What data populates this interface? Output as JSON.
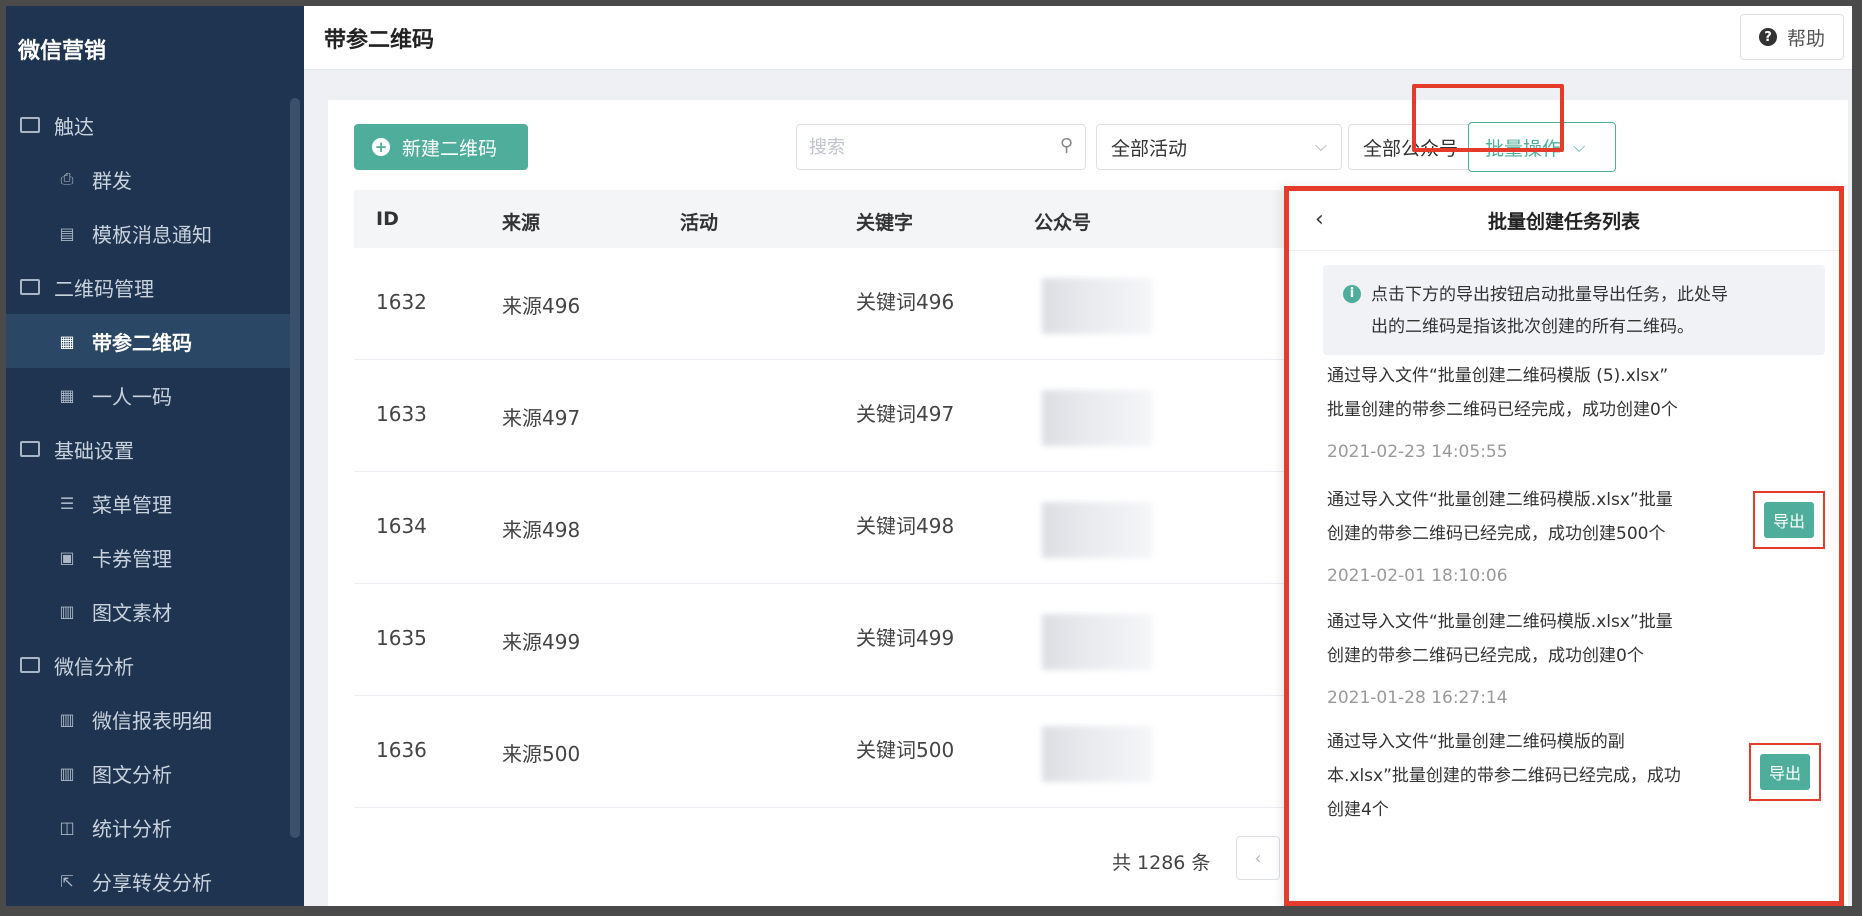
{
  "sidebar": {
    "brand": "微信营销",
    "items": [
      {
        "label": "触达",
        "type": "group",
        "icon": "folder-icon"
      },
      {
        "label": "群发",
        "type": "sub",
        "icon": "broadcast-icon"
      },
      {
        "label": "模板消息通知",
        "type": "sub",
        "icon": "template-icon"
      },
      {
        "label": "二维码管理",
        "type": "group",
        "icon": "folder-icon"
      },
      {
        "label": "带参二维码",
        "type": "sub",
        "icon": "qrcode-icon",
        "active": true
      },
      {
        "label": "一人一码",
        "type": "sub",
        "icon": "qrcode-icon"
      },
      {
        "label": "基础设置",
        "type": "group",
        "icon": "folder-icon"
      },
      {
        "label": "菜单管理",
        "type": "sub",
        "icon": "list-icon"
      },
      {
        "label": "卡券管理",
        "type": "sub",
        "icon": "coupon-icon"
      },
      {
        "label": "图文素材",
        "type": "sub",
        "icon": "document-icon"
      },
      {
        "label": "微信分析",
        "type": "group",
        "icon": "folder-icon"
      },
      {
        "label": "微信报表明细",
        "type": "sub",
        "icon": "document-icon"
      },
      {
        "label": "图文分析",
        "type": "sub",
        "icon": "document-icon"
      },
      {
        "label": "统计分析",
        "type": "sub",
        "icon": "chart-icon"
      },
      {
        "label": "分享转发分析",
        "type": "sub",
        "icon": "share-icon"
      }
    ]
  },
  "header": {
    "title": "带参二维码",
    "help_label": "帮助"
  },
  "toolbar": {
    "new_label": "新建二维码",
    "search_placeholder": "搜索",
    "activity_select": "全部活动",
    "account_select": "全部公众号",
    "batch_label": "批量操作"
  },
  "table": {
    "columns": [
      "ID",
      "来源",
      "活动",
      "关键字",
      "公众号"
    ],
    "rows": [
      {
        "id": "1632",
        "source": "来源496",
        "activity": "",
        "keyword": "关键词496"
      },
      {
        "id": "1633",
        "source": "来源497",
        "activity": "",
        "keyword": "关键词497"
      },
      {
        "id": "1634",
        "source": "来源498",
        "activity": "",
        "keyword": "关键词498"
      },
      {
        "id": "1635",
        "source": "来源499",
        "activity": "",
        "keyword": "关键词499"
      },
      {
        "id": "1636",
        "source": "来源500",
        "activity": "",
        "keyword": "关键词500"
      }
    ],
    "total": "共 1286 条"
  },
  "drawer": {
    "title": "批量创建任务列表",
    "notice_line1": "点击下方的导出按钮启动批量导出任务，此处导",
    "notice_line2": "出的二维码是指该批次创建的所有二维码。",
    "export_label": "导出",
    "tasks": [
      {
        "line1": "通过导入文件“批量创建二维码模版 (5).xlsx”",
        "line2": "批量创建的带参二维码已经完成，成功创建0个",
        "time": "2021-02-23 14:05:55",
        "exportable": false
      },
      {
        "line1": "通过导入文件“批量创建二维码模版.xlsx”批量",
        "line2": "创建的带参二维码已经完成，成功创建500个",
        "time": "2021-02-01 18:10:06",
        "exportable": true
      },
      {
        "line1": "通过导入文件“批量创建二维码模版.xlsx”批量",
        "line2": "创建的带参二维码已经完成，成功创建0个",
        "time": "2021-01-28 16:27:14",
        "exportable": false
      },
      {
        "line1": "通过导入文件“批量创建二维码模版的副",
        "line2": "本.xlsx”批量创建的带参二维码已经完成，成功",
        "line3": "创建4个",
        "exportable": true
      }
    ]
  },
  "colors": {
    "sidebar_bg": "#1e3450",
    "accent": "#4fae9b",
    "highlight": "#e53b2c"
  }
}
